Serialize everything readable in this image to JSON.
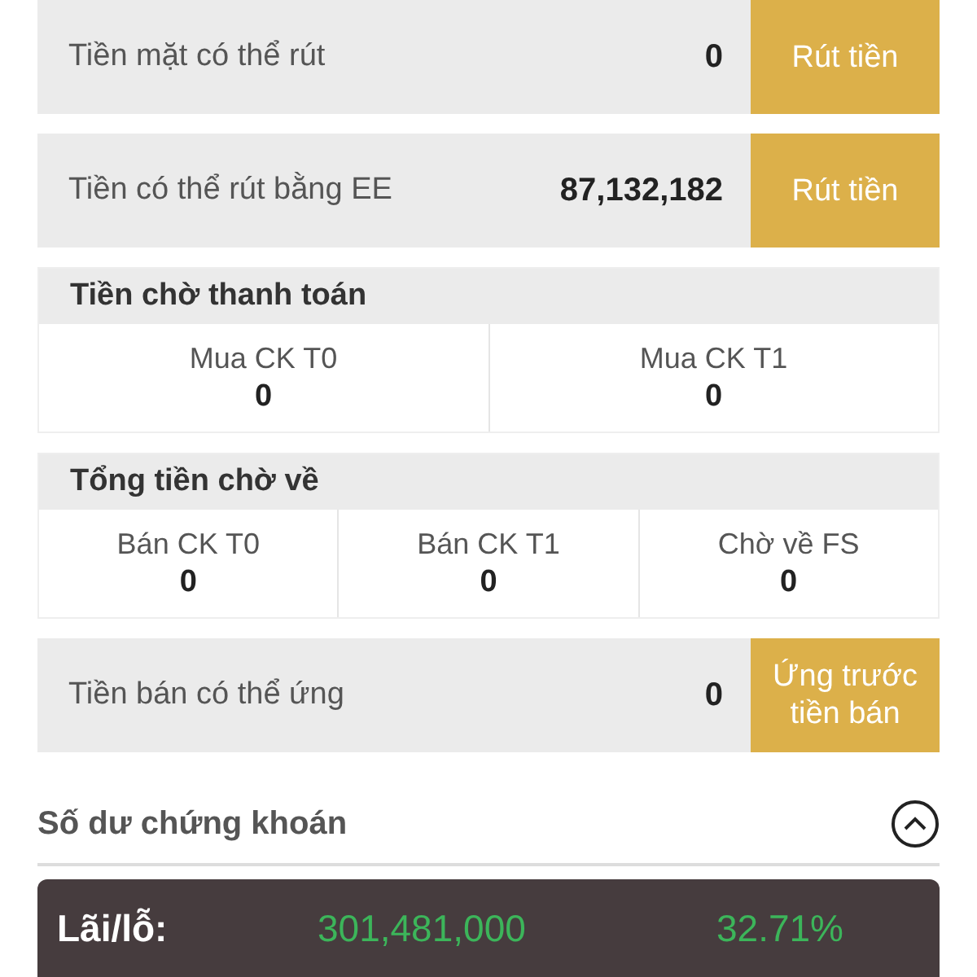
{
  "blocks": [
    {
      "kind": "action",
      "label": "Tiền mặt có thể rút",
      "value": "0",
      "button": "Rút tiền"
    },
    {
      "kind": "action",
      "label": "Tiền có thể rút bằng EE",
      "value": "87,132,182",
      "button": "Rút tiền"
    },
    {
      "kind": "group",
      "title": "Tiền chờ thanh toán",
      "cells": [
        {
          "label": "Mua CK T0",
          "value": "0"
        },
        {
          "label": "Mua CK T1",
          "value": "0"
        }
      ]
    },
    {
      "kind": "group",
      "title": "Tổng tiền chờ về",
      "cells": [
        {
          "label": "Bán CK T0",
          "value": "0"
        },
        {
          "label": "Bán CK T1",
          "value": "0"
        },
        {
          "label": "Chờ về FS",
          "value": "0"
        }
      ]
    },
    {
      "kind": "action",
      "label": "Tiền bán có thể ứng",
      "value": "0",
      "button": "Ứng trước tiền bán"
    }
  ],
  "section": {
    "title": "Số dư chứng khoán",
    "expanded": true
  },
  "profit_loss": {
    "label": "Lãi/lỗ:",
    "amount": "301,481,000",
    "percent": "32.71%"
  }
}
